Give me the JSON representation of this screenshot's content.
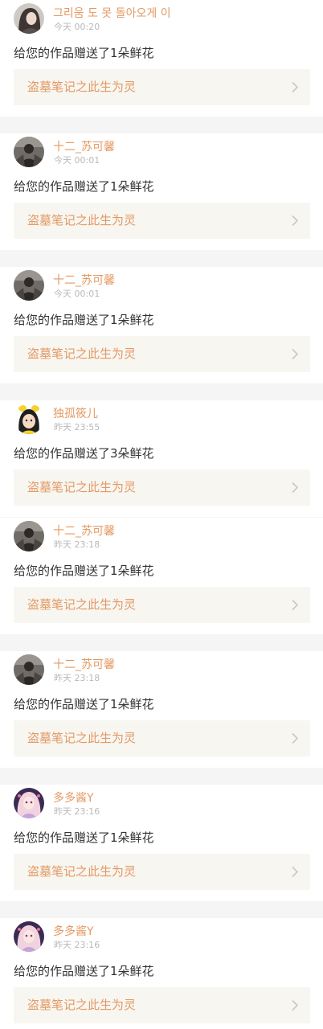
{
  "feed": {
    "items": [
      {
        "user": "그리움 도 못 돌아오게 이",
        "time": "今天 00:20",
        "message": "给您的作品赠送了1朵鲜花",
        "work_title": "盗墓笔记之此生为灵",
        "avatar": "avatar-girl-dark-hair"
      },
      {
        "user": "十二_苏可馨",
        "time": "今天 00:01",
        "message": "给您的作品赠送了1朵鲜花",
        "work_title": "盗墓笔记之此生为灵",
        "avatar": "avatar-dark-figure"
      },
      {
        "user": "十二_苏可馨",
        "time": "今天 00:01",
        "message": "给您的作品赠送了1朵鲜花",
        "work_title": "盗墓笔记之此生为灵",
        "avatar": "avatar-dark-figure"
      },
      {
        "user": "独孤筱儿",
        "time": "昨天 23:55",
        "message": "给您的作品赠送了3朵鲜花",
        "work_title": "盗墓笔记之此生为灵",
        "avatar": "avatar-cartoon-yellow"
      },
      {
        "user": "十二_苏可馨",
        "time": "昨天 23:18",
        "message": "给您的作品赠送了1朵鲜花",
        "work_title": "盗墓笔记之此生为灵",
        "avatar": "avatar-dark-figure"
      },
      {
        "user": "十二_苏可馨",
        "time": "昨天 23:18",
        "message": "给您的作品赠送了1朵鲜花",
        "work_title": "盗墓笔记之此生为灵",
        "avatar": "avatar-dark-figure"
      },
      {
        "user": "多多酱Y",
        "time": "昨天 23:16",
        "message": "给您的作品赠送了1朵鲜花",
        "work_title": "盗墓笔记之此生为灵",
        "avatar": "avatar-anime-girl"
      },
      {
        "user": "多多酱Y",
        "time": "昨天 23:16",
        "message": "给您的作品赠送了1朵鲜花",
        "work_title": "盗墓笔记之此生为灵",
        "avatar": "avatar-anime-girl"
      }
    ]
  },
  "colors": {
    "accent": "#e49963",
    "card_bg": "#f7f6f1",
    "page_bg": "#f5f5f5",
    "text": "#333333",
    "muted": "#b9b9b9"
  }
}
